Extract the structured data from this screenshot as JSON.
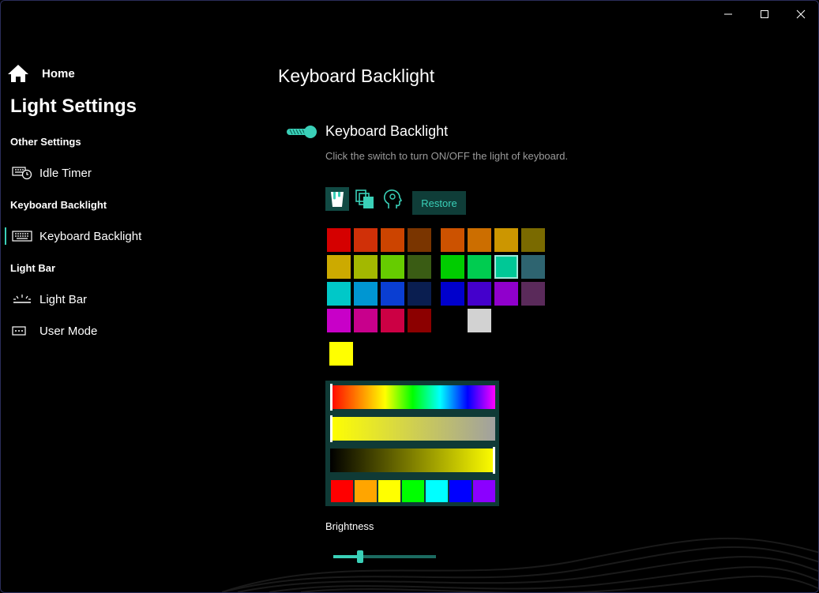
{
  "window": {
    "minimize": "minimize",
    "maximize": "maximize",
    "close": "close"
  },
  "sidebar": {
    "home_label": "Home",
    "app_title": "Light Settings",
    "sections": [
      {
        "title": "Other Settings",
        "items": [
          {
            "label": "Idle Timer",
            "icon": "idle-timer-icon"
          }
        ]
      },
      {
        "title": "Keyboard Backlight",
        "items": [
          {
            "label": "Keyboard Backlight",
            "icon": "keyboard-icon",
            "selected": true
          }
        ]
      },
      {
        "title": "Light Bar",
        "items": [
          {
            "label": "Light Bar",
            "icon": "light-bar-icon"
          },
          {
            "label": "User Mode",
            "icon": "user-mode-icon"
          }
        ]
      }
    ]
  },
  "main": {
    "page_title": "Keyboard Backlight",
    "toggle": {
      "label": "Keyboard Backlight",
      "description": "Click the switch to turn ON/OFF the light of keyboard.",
      "on": true
    },
    "tools": {
      "restore_label": "Restore",
      "icons": [
        "paint-bucket-icon",
        "copy-layers-icon",
        "head-profile-icon"
      ]
    },
    "palette_left": [
      "#d50000",
      "#d03008",
      "#cc4400",
      "#7a3500",
      "#ccaa00",
      "#a3b800",
      "#66cc00",
      "#3a5c14",
      "#00c8c8",
      "#0096d2",
      "#0a3ed2",
      "#0a1e50",
      "#c800c8",
      "#c8008c",
      "#cc0044",
      "#8c0000"
    ],
    "palette_right": [
      "#cc5200",
      "#cc6e00",
      "#cc9600",
      "#7a6a00",
      "#00cc00",
      "#00cc50",
      "#00c896",
      "#2e6470",
      "#0000cc",
      "#4400cc",
      "#9000cc",
      "#5a2a5a",
      null,
      "#d2d2d2",
      null,
      null
    ],
    "selected_swatch_index": 6,
    "current_color": "#ffff00",
    "picker": {
      "hue": 0.0,
      "saturation": 0.0,
      "value": 1.0,
      "presets": [
        "#ff0000",
        "#ffa500",
        "#ffff00",
        "#00ff00",
        "#00ffff",
        "#0000ff",
        "#8b00ff"
      ]
    },
    "brightness": {
      "label": "Brightness",
      "value": 0.26
    }
  },
  "colors": {
    "accent": "#3ad0b8",
    "panel": "#0f3a36"
  }
}
